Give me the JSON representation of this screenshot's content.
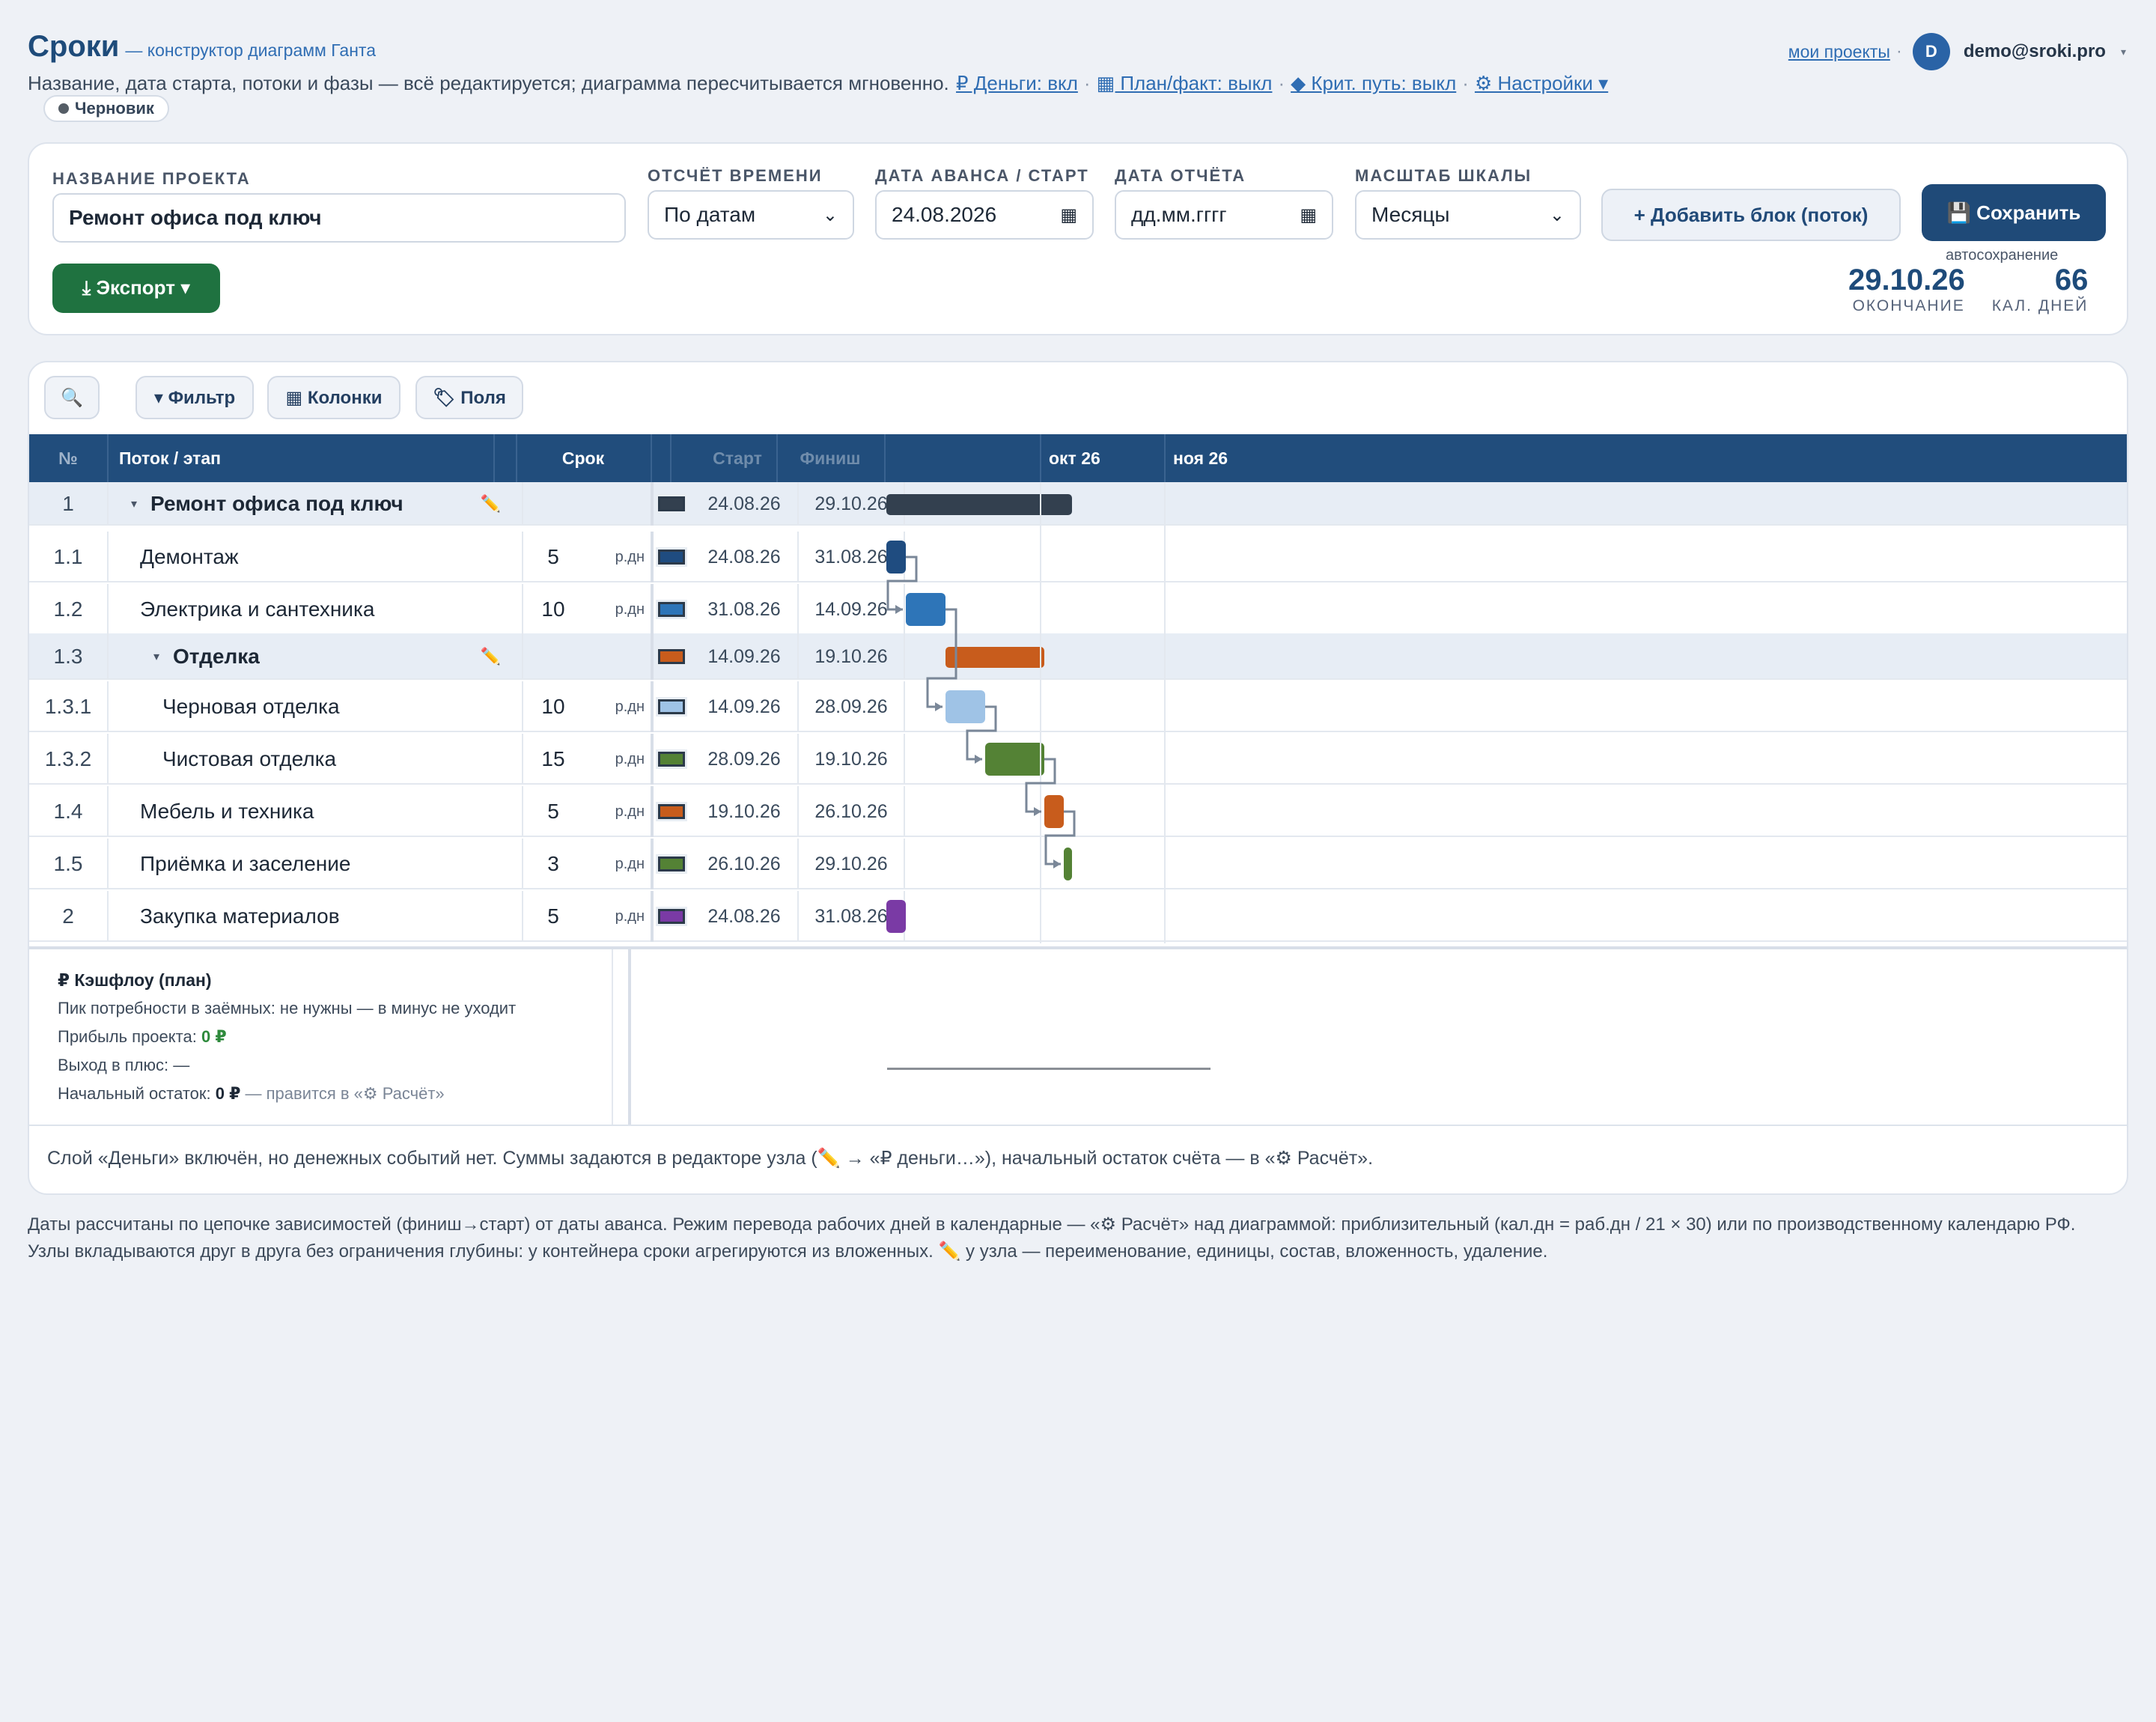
{
  "header": {
    "brand": "Сроки",
    "brand_sub": "— конструктор диаграмм Ганта",
    "subtitle": "Название, дата старта, потоки и фазы — всё редактируется; диаграмма пересчитывается мгновенно.",
    "toggles": [
      "₽ Деньги: вкл",
      "▦ План/факт: выкл",
      "◆ Крит. путь: выкл",
      "⚙ Настройки ▾"
    ],
    "status_badge": "Черновик",
    "my_projects": "мои проекты",
    "avatar_letter": "D",
    "user_email": "demo@sroki.pro"
  },
  "form": {
    "project_name_label": "НАЗВАНИЕ ПРОЕКТА",
    "project_name": "Ремонт офиса под ключ",
    "time_mode_label": "ОТСЧЁТ ВРЕМЕНИ",
    "time_mode": "По датам",
    "start_label": "ДАТА АВАНСА / СТАРТ",
    "start_date": "24.08.2026",
    "report_label": "ДАТА ОТЧЁТА",
    "report_placeholder": "дд.мм.гггг",
    "scale_label": "МАСШТАБ ШКАЛЫ",
    "scale": "Месяцы",
    "add_block": "+ Добавить блок (поток)",
    "save": "💾 Сохранить",
    "autosave": "автосохранение",
    "export": "⤓ Экспорт ▾",
    "end_date": "29.10.26",
    "end_caption": "ОКОНЧАНИЕ",
    "days": "66",
    "days_caption": "КАЛ. ДНЕЙ"
  },
  "toolbar": {
    "search_icon": "🔍",
    "filter": "▾ Фильтр",
    "columns": "▦ Колонки",
    "fields": "🏷 Поля"
  },
  "table": {
    "headers": {
      "num": "№",
      "name": "Поток / этап",
      "dur": "Срок",
      "start": "Старт",
      "finish": "Финиш"
    },
    "months": [
      "окт 26",
      "ноя 26"
    ],
    "rows": [
      {
        "num": "1",
        "name": "Ремонт офиса под ключ",
        "dur": "",
        "unit": "",
        "start": "24.08.26",
        "finish": "29.10.26",
        "color": "#33404f",
        "group": true,
        "level": 0
      },
      {
        "num": "1.1",
        "name": "Демонтаж",
        "dur": "5",
        "unit": "р.дн",
        "start": "24.08.26",
        "finish": "31.08.26",
        "color": "#1f4c80",
        "level": 1
      },
      {
        "num": "1.2",
        "name": "Электрика и сантехника",
        "dur": "10",
        "unit": "р.дн",
        "start": "31.08.26",
        "finish": "14.09.26",
        "color": "#2e75b8",
        "level": 1
      },
      {
        "num": "1.3",
        "name": "Отделка",
        "dur": "",
        "unit": "",
        "start": "14.09.26",
        "finish": "19.10.26",
        "color": "#c85c1c",
        "group": true,
        "level": 1
      },
      {
        "num": "1.3.1",
        "name": "Черновая отделка",
        "dur": "10",
        "unit": "р.дн",
        "start": "14.09.26",
        "finish": "28.09.26",
        "color": "#9fc3e6",
        "level": 2
      },
      {
        "num": "1.3.2",
        "name": "Чистовая отделка",
        "dur": "15",
        "unit": "р.дн",
        "start": "28.09.26",
        "finish": "19.10.26",
        "color": "#548235",
        "level": 2
      },
      {
        "num": "1.4",
        "name": "Мебель и техника",
        "dur": "5",
        "unit": "р.дн",
        "start": "19.10.26",
        "finish": "26.10.26",
        "color": "#c85c1c",
        "level": 1
      },
      {
        "num": "1.5",
        "name": "Приёмка и заселение",
        "dur": "3",
        "unit": "р.дн",
        "start": "26.10.26",
        "finish": "29.10.26",
        "color": "#548235",
        "level": 1
      },
      {
        "num": "2",
        "name": "Закупка материалов",
        "dur": "5",
        "unit": "р.дн",
        "start": "24.08.26",
        "finish": "31.08.26",
        "color": "#7a3aa5",
        "level": 1
      }
    ]
  },
  "cashflow": {
    "title": "₽ Кэшфлоу (план)",
    "peak": "Пик потребности в заёмных: не нужны — в минус не уходит",
    "profit_label": "Прибыль проекта:",
    "profit_value": "0 ₽",
    "breakeven": "Выход в плюс: —",
    "balance_label": "Начальный остаток:",
    "balance_value": "0 ₽",
    "balance_hint": "— правится в «⚙ Расчёт»",
    "note": "Слой «Деньги» включён, но денежных событий нет. Суммы задаются в редакторе узла (✏️ → «₽ деньги…»), начальный остаток счёта — в «⚙ Расчёт»."
  },
  "footer": "Даты рассчитаны по цепочке зависимостей (финиш→старт) от даты аванса. Режим перевода рабочих дней в календарные — «⚙ Расчёт» над диаграммой: приблизительный (кал.дн = раб.дн / 21 × 30) или по производственному календарю РФ. Узлы вкладываются друг в друга без ограничения глубины: у контейнера сроки агрегируются из вложенных. ✏️ у узла — переименование, единицы, состав, вложенность, удаление."
}
